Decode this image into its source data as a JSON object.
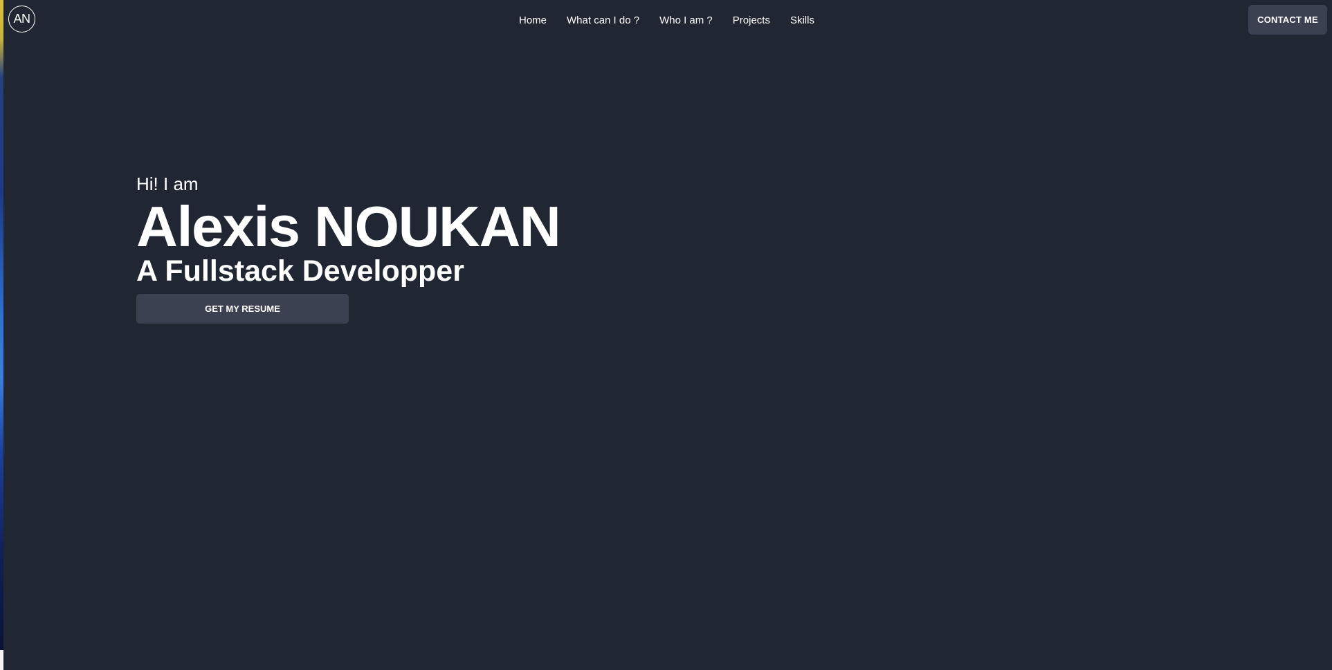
{
  "header": {
    "logo_text": "AN",
    "nav": [
      {
        "label": "Home"
      },
      {
        "label": "What can I do ?"
      },
      {
        "label": "Who I am ?"
      },
      {
        "label": "Projects"
      },
      {
        "label": "Skills"
      }
    ],
    "contact_label": "CONTACT ME"
  },
  "hero": {
    "greeting": "Hi! I am",
    "name": "Alexis NOUKAN",
    "role": "A Fullstack Developper",
    "resume_label": "GET MY RESUME"
  },
  "colors": {
    "background": "#212732",
    "button": "#3b4150",
    "text": "#ffffff"
  }
}
